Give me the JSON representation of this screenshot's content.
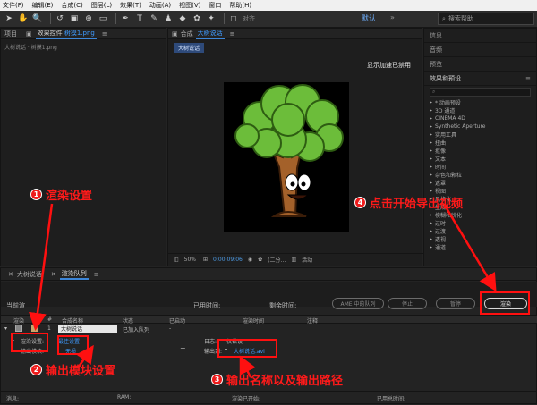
{
  "menu": [
    "文件(F)",
    "编辑(E)",
    "合成(C)",
    "图层(L)",
    "效果(T)",
    "动画(A)",
    "视图(V)",
    "窗口",
    "帮助(H)"
  ],
  "toolbar": {
    "snap_label": "对齐",
    "workspace": "默认",
    "workspace_more": "»",
    "search_placeholder": "搜索帮助"
  },
  "project": {
    "tab": "项目",
    "effects_tab": "效果控件",
    "effects_file": "树摸1.png",
    "breadcrumb": "大树说话 · 树摸1.png"
  },
  "composition": {
    "tab": "合成",
    "comp_name": "大树说话",
    "comp_chip": "大树说话",
    "accel_text": "显示加速已禁用",
    "zoom": "50%",
    "timecode": "0:00:09:06",
    "resolution": "(二分…",
    "activity": "活动"
  },
  "right_panel": {
    "items": [
      "信息",
      "音频",
      "预览"
    ],
    "effects_title": "效果和预设",
    "fx": [
      "* 动画预设",
      "3D 通道",
      "CINEMA 4D",
      "Synthetic Aperture",
      "实用工具",
      "扭曲",
      "抠像",
      "文本",
      "时间",
      "杂色和颗粒",
      "遮罩",
      "视图",
      "风格化",
      "生成",
      "模糊和锐化",
      "过时",
      "过渡",
      "透视",
      "通道"
    ]
  },
  "queue": {
    "tab_timeline": "大树说话",
    "tab_render": "渲染队列",
    "current": "当前渲",
    "elapsed": "已用时间:",
    "remaining": "剩余时间:",
    "ame_btn": "AME 中的队列",
    "stop_btn": "停止",
    "pause_btn": "暂停",
    "render_btn": "渲染",
    "cols": [
      "渲染",
      "#",
      "合成名称",
      "状态",
      "已启动",
      "渲染时间",
      "注释"
    ],
    "row_num": "1",
    "row_comp": "大树说话",
    "row_status": "已加入队列",
    "row_started": "-",
    "settings_label": "渲染设置:",
    "settings_value": "最佳设置",
    "module_label": "输出模块:",
    "module_value": "无损",
    "log_label": "日志:",
    "log_value": "仅错误",
    "output_label": "输出到:",
    "output_value": "大树说话.avi",
    "status_msg": "消息:",
    "status_ram": "RAM:",
    "status_started": "渲染已开始:",
    "status_total": "已用总时间:"
  },
  "annotations": {
    "n1": "1",
    "t1": "渲染设置",
    "n2": "2",
    "t2": "输出模块设置",
    "n3": "3",
    "t3": "输出名称以及输出路径",
    "n4": "4",
    "t4": "点击开始导出视频"
  },
  "colors": {
    "accent": "#3f9bff",
    "annotation": "#ff1a1a",
    "tree_leaves": "#6cbd3a",
    "tree_trunk": "#a4612a"
  }
}
